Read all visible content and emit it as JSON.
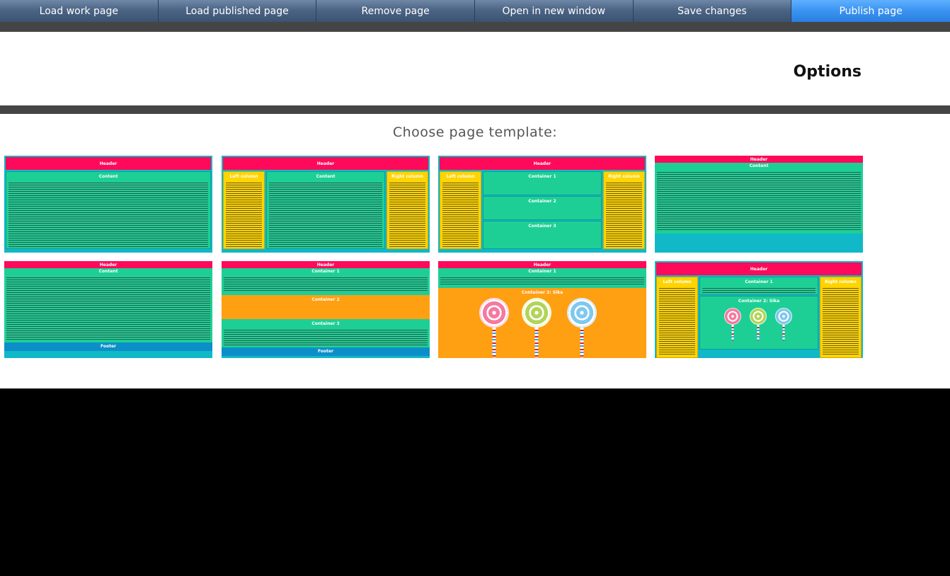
{
  "toolbar": {
    "buttons": [
      {
        "label": "Load work page"
      },
      {
        "label": "Load published page"
      },
      {
        "label": "Remove page"
      },
      {
        "label": "Open in new window"
      },
      {
        "label": "Save changes"
      },
      {
        "label": "Publish page"
      }
    ]
  },
  "options": {
    "title": "Options"
  },
  "templates": {
    "title": "Choose page template:",
    "labels": {
      "header": "Header",
      "content": "Content",
      "left_column": "Left column",
      "right_column": "Right column",
      "container_1": "Container 1",
      "container_2": "Container 2",
      "container_3": "Container 3",
      "container_2_sika": "Container 2: Sika",
      "footer": "Footer"
    }
  }
}
